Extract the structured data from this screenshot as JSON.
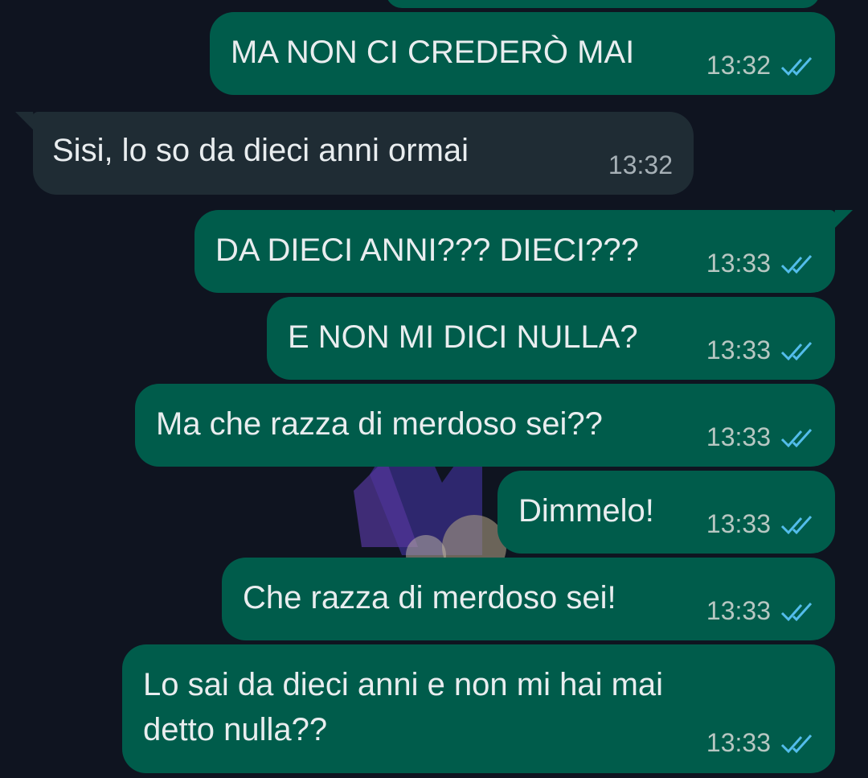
{
  "messages": [
    {
      "id": "m1",
      "direction": "outgoing",
      "text": "MA NON CI CREDERÒ MAI",
      "time": "13:32",
      "status": "read"
    },
    {
      "id": "m2",
      "direction": "incoming",
      "text": "Sisi, lo so da dieci anni ormai",
      "time": "13:32"
    },
    {
      "id": "m3",
      "direction": "outgoing",
      "text": "DA DIECI ANNI??? DIECI???",
      "time": "13:33",
      "status": "read"
    },
    {
      "id": "m4",
      "direction": "outgoing",
      "text": "E NON MI DICI NULLA?",
      "time": "13:33",
      "status": "read"
    },
    {
      "id": "m5",
      "direction": "outgoing",
      "text": "Ma che razza di merdoso sei??",
      "time": "13:33",
      "status": "read"
    },
    {
      "id": "m6",
      "direction": "outgoing",
      "text": "Dimmelo!",
      "time": "13:33",
      "status": "read"
    },
    {
      "id": "m7",
      "direction": "outgoing",
      "text": "Che razza di merdoso sei!",
      "time": "13:33",
      "status": "read"
    },
    {
      "id": "m8",
      "direction": "outgoing",
      "text_line1": "Lo sai da dieci anni e non mi hai mai",
      "text_line2": "detto nulla??",
      "time": "13:33",
      "status": "read"
    }
  ],
  "colors": {
    "background": "#0f1420",
    "outgoing_bubble": "#005c4b",
    "incoming_bubble": "#1f2c34",
    "read_ticks": "#53bdeb"
  },
  "icons": {
    "read_receipt": "double-check-icon"
  }
}
